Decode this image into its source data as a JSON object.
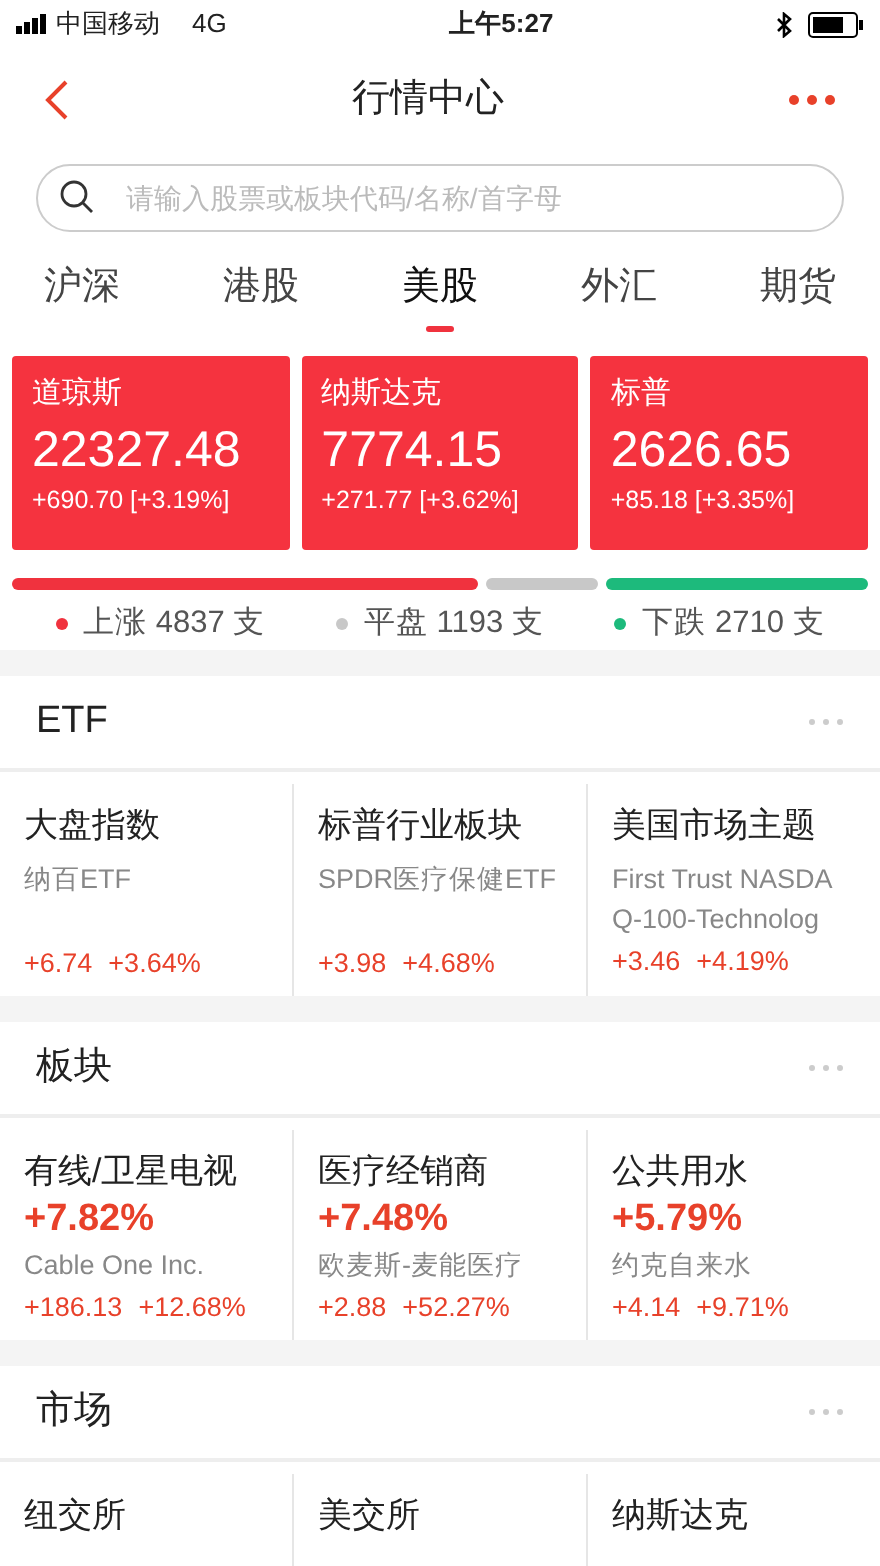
{
  "status_bar": {
    "carrier": "中国移动",
    "network": "4G",
    "time": "上午5:27"
  },
  "header": {
    "title": "行情中心"
  },
  "search": {
    "placeholder": "请输入股票或板块代码/名称/首字母"
  },
  "tabs": [
    {
      "label": "沪深",
      "selected": false
    },
    {
      "label": "港股",
      "selected": false
    },
    {
      "label": "美股",
      "selected": true
    },
    {
      "label": "外汇",
      "selected": false
    },
    {
      "label": "期货",
      "selected": false
    }
  ],
  "indices": [
    {
      "name": "道琼斯",
      "value": "22327.48",
      "change": "+690.70 [+3.19%]"
    },
    {
      "name": "纳斯达克",
      "value": "7774.15",
      "change": "+271.77 [+3.62%]"
    },
    {
      "name": "标普",
      "value": "2626.65",
      "change": "+85.18 [+3.35%]"
    }
  ],
  "breadth": [
    {
      "label": "上涨 4837 支",
      "color": "#f0323e"
    },
    {
      "label": "平盘 1193 支",
      "color": "#c8c8c8"
    },
    {
      "label": "下跌 2710 支",
      "color": "#1dba7c"
    }
  ],
  "sections": [
    {
      "title": "ETF",
      "kind": "etf",
      "items": [
        {
          "name": "大盘指数",
          "sub_lines": [
            "纳百ETF"
          ],
          "change": "+6.74",
          "pct": "+3.64%"
        },
        {
          "name": "标普行业板块",
          "sub_lines": [
            "SPDR医疗保健ETF"
          ],
          "change": "+3.98",
          "pct": "+4.68%"
        },
        {
          "name": "美国市场主题",
          "sub_lines": [
            "First Trust NASDA",
            "Q-100-Technolog"
          ],
          "change": "+3.46",
          "pct": "+4.19%"
        }
      ]
    },
    {
      "title": "板块",
      "kind": "sector",
      "items": [
        {
          "name": "有线/卫星电视",
          "pct": "+7.82%",
          "leader": "Cable One Inc.",
          "change": "+186.13",
          "leader_pct": "+12.68%"
        },
        {
          "name": "医疗经销商",
          "pct": "+7.48%",
          "leader": "欧麦斯-麦能医疗",
          "change": "+2.88",
          "leader_pct": "+52.27%"
        },
        {
          "name": "公共用水",
          "pct": "+5.79%",
          "leader": "约克自来水",
          "change": "+4.14",
          "leader_pct": "+9.71%"
        }
      ]
    },
    {
      "title": "市场",
      "kind": "market",
      "items": [
        {
          "name": "纽交所"
        },
        {
          "name": "美交所"
        },
        {
          "name": "纳斯达克"
        }
      ]
    }
  ]
}
